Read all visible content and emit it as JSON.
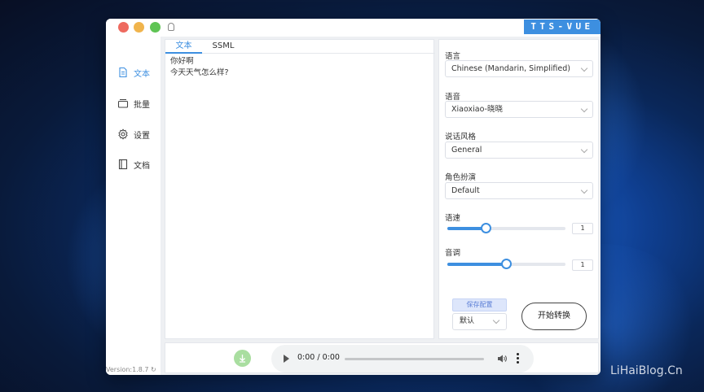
{
  "window": {
    "brand": "TTS-VUE",
    "version": "Version:1.8.7"
  },
  "sidebar": {
    "items": [
      {
        "label": "文本",
        "icon": "document-icon",
        "active": true
      },
      {
        "label": "批量",
        "icon": "batch-icon",
        "active": false
      },
      {
        "label": "设置",
        "icon": "gear-icon",
        "active": false
      },
      {
        "label": "文档",
        "icon": "book-icon",
        "active": false
      }
    ]
  },
  "editor": {
    "tabs": [
      "文本",
      "SSML"
    ],
    "active_tab": "文本",
    "text": "你好啊\n今天天气怎么样?"
  },
  "config": {
    "language_label": "语言",
    "language_value": "Chinese (Mandarin, Simplified)",
    "voice_label": "语音",
    "voice_value": "Xiaoxiao-晓晓",
    "style_label": "说话风格",
    "style_value": "General",
    "role_label": "角色扮演",
    "role_value": "Default",
    "rate_label": "语速",
    "rate_value": "1",
    "rate_fraction": 0.33,
    "pitch_label": "音调",
    "pitch_value": "1",
    "pitch_fraction": 0.5,
    "save_label": "保存配置",
    "preset_value": "默认",
    "convert_label": "开始转换"
  },
  "player": {
    "time": "0:00 / 0:00"
  },
  "watermark": "LiHaiBlog.Cn",
  "colors": {
    "accent": "#3d8fe0",
    "download_button": "#a9dea0",
    "close_dot": "#ee6a5f",
    "minimize_dot": "#f0b44c",
    "maximize_dot": "#5fc454"
  }
}
